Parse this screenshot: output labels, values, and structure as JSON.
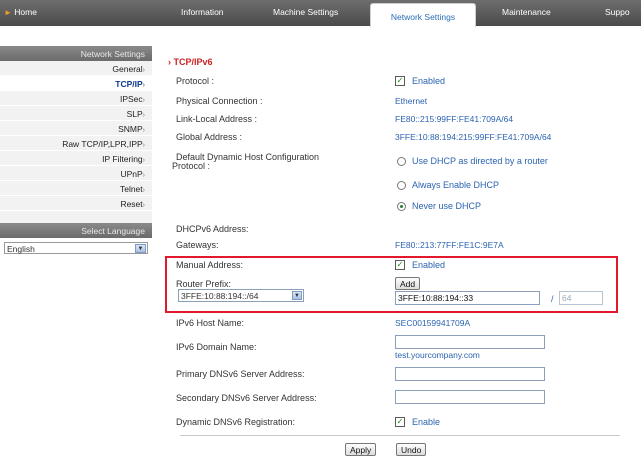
{
  "nav": {
    "home": "Home",
    "tabs": [
      "Information",
      "Machine Settings",
      "Network Settings",
      "Maintenance",
      "Suppo"
    ]
  },
  "sidebar": {
    "header": "Network Settings",
    "items": [
      {
        "label": "General"
      },
      {
        "label": "TCP/IP"
      },
      {
        "label": "IPSec"
      },
      {
        "label": "SLP"
      },
      {
        "label": "SNMP"
      },
      {
        "label": "Raw TCP/IP,LPR,IPP"
      },
      {
        "label": "IP Filtering"
      },
      {
        "label": "UPnP"
      },
      {
        "label": "Telnet"
      },
      {
        "label": "Reset"
      }
    ],
    "selected": "TCP/IP",
    "language_header": "Select Language",
    "language_value": "English"
  },
  "main": {
    "title": "TCP/IPv6",
    "protocol_label": "Protocol :",
    "protocol_value": "Enabled",
    "physical_label": "Physical Connection :",
    "physical_value": "Ethernet",
    "link_local_label": "Link-Local Address :",
    "link_local_value": "FE80::215:99FF:FE41:709A/64",
    "global_label": "Global Address :",
    "global_value": "3FFE:10:88:194:215:99FF:FE41:709A/64",
    "dhcp_label_1": "Default Dynamic Host Configuration",
    "dhcp_label_2": "Protocol :",
    "dhcp_options": [
      "Use DHCP as directed by a router",
      "Always Enable DHCP",
      "Never use DHCP"
    ],
    "dhcp_selected": "Never use DHCP",
    "dhcpv6_label": "DHCPv6 Address:",
    "gateways_label": "Gateways:",
    "gateways_value": "FE80::213:77FF:FE1C:9E7A",
    "manual_label": "Manual Address:",
    "manual_value": "Enabled",
    "router_prefix_label": "Router Prefix:",
    "router_prefix_value": "3FFE:10:88:194::/64",
    "add_label": "Add",
    "address_value": "3FFE:10:88:194::33",
    "prefix_sep": "/",
    "prefix_len": "64",
    "host_name_label": "IPv6 Host Name:",
    "host_name_value": "SEC00159941709A",
    "domain_label": "IPv6 Domain Name:",
    "domain_value": "test.yourcompany.com",
    "primary_dns_label": "Primary DNSv6 Server Address:",
    "secondary_dns_label": "Secondary DNSv6 Server Address:",
    "dynamic_dns_label": "Dynamic DNSv6 Registration:",
    "dynamic_dns_value": "Enable",
    "apply_label": "Apply",
    "undo_label": "Undo"
  }
}
